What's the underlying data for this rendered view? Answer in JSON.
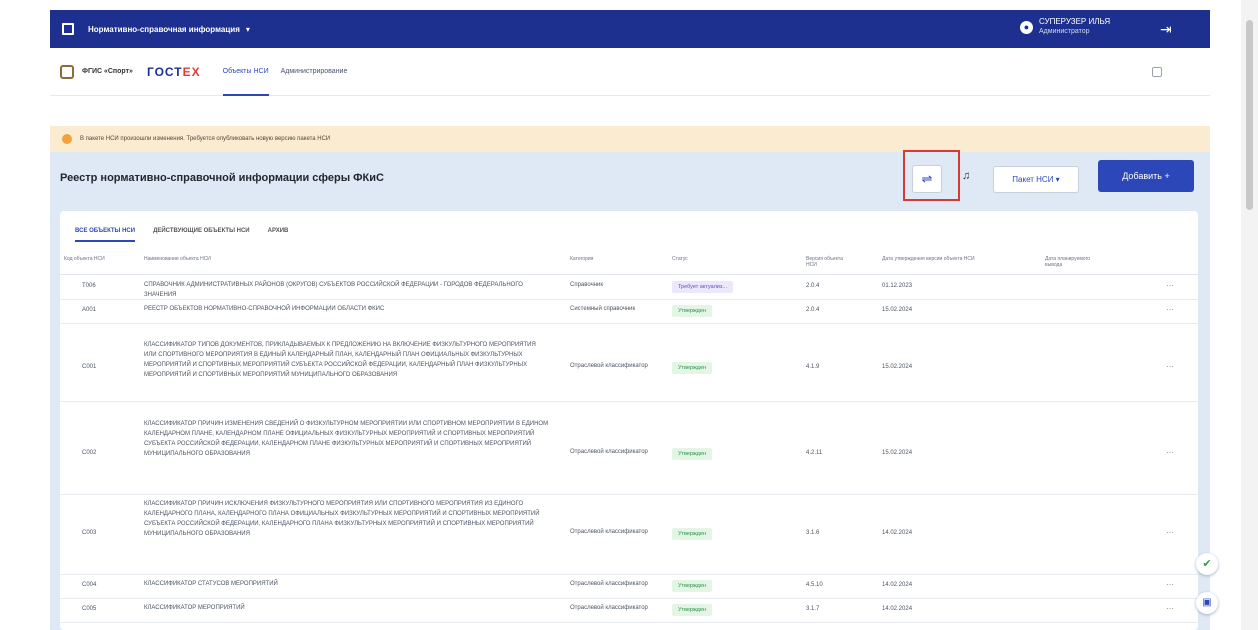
{
  "topbar": {
    "app_title": "Нормативно-справочная информация",
    "caret": "▾",
    "user_name": "СУПЕРУЗЕР ИЛЬЯ",
    "user_role": "Администратор",
    "logout_icon": "logout-icon",
    "bg_color": "#1d2f8f"
  },
  "nav": {
    "org": "ФГИС «Спорт»",
    "gost_blue": "ГОСТ",
    "gost_red": "ЕХ",
    "tabs": [
      "Объекты НСИ",
      "Администрирование"
    ]
  },
  "warning": {
    "text": "В пакете НСИ произошли изменения. Требуется опубликовать новую версию пакета НСИ"
  },
  "page": {
    "title": "Реестр нормативно-справочной информации сферы ФКиС",
    "paket_label": "Пакет НСИ",
    "add_label": "Добавить",
    "accent": "#2b47b8",
    "highlight_color": "#d63a36"
  },
  "tabs": [
    "ВСЕ ОБЪЕКТЫ НСИ",
    "ДЕЙСТВУЮЩИЕ ОБЪЕКТЫ НСИ",
    "АРХИВ"
  ],
  "table": {
    "headers": [
      "Код объекта НСИ",
      "Наименование объекта НСИ",
      "Категория",
      "Статус",
      "Версия объекта НСИ",
      "Дата утверждения версии объекта НСИ",
      "Дата планируемого вывода"
    ],
    "rows": [
      {
        "code": "Т006",
        "name": "СПРАВОЧНИК АДМИНИСТРАТИВНЫХ РАЙОНОВ (ОКРУГОВ) СУБЪЕКТОВ РОССИЙСКОЙ ФЕДЕРАЦИИ - ГОРОДОВ ФЕДЕРАЛЬНОГО ЗНАЧЕНИЯ",
        "category": "Справочник",
        "status": "Требует актуализ...",
        "version": "2.0.4",
        "date": "01.12.2023"
      },
      {
        "code": "А001",
        "name": "РЕЕСТР ОБЪЕКТОВ НОРМАТИВНО-СПРАВОЧНОЙ ИНФОРМАЦИИ ОБЛАСТИ ФКИС",
        "category": "Системный справочник",
        "status": "Утвержден",
        "version": "2.0.4",
        "date": "15.02.2024"
      },
      {
        "code": "С001",
        "name": "КЛАССИФИКАТОР ТИПОВ ДОКУМЕНТОВ, ПРИКЛАДЫВАЕМЫХ К ПРЕДЛОЖЕНИЮ НА ВКЛЮЧЕНИЕ ФИЗКУЛЬТУРНОГО МЕРОПРИЯТИЯ ИЛИ СПОРТИВНОГО МЕРОПРИЯТИЯ В ЕДИНЫЙ КАЛЕНДАРНЫЙ ПЛАН, КАЛЕНДАРНЫЙ ПЛАН ОФИЦИАЛЬНЫХ ФИЗКУЛЬТУРНЫХ МЕРОПРИЯТИЙ И СПОРТИВНЫХ МЕРОПРИЯТИЙ СУБЪЕКТА РОССИЙСКОЙ ФЕДЕРАЦИИ, КАЛЕНДАРНЫЙ ПЛАН ФИЗКУЛЬТУРНЫХ МЕРОПРИЯТИЙ И СПОРТИВНЫХ МЕРОПРИЯТИЙ МУНИЦИПАЛЬНОГО ОБРАЗОВАНИЯ",
        "category": "Отраслевой классификатор",
        "status": "Утвержден",
        "version": "4.1.9",
        "date": "15.02.2024"
      },
      {
        "code": "С002",
        "name": "КЛАССИФИКАТОР ПРИЧИН ИЗМЕНЕНИЯ СВЕДЕНИЙ О ФИЗКУЛЬТУРНОМ МЕРОПРИЯТИИ ИЛИ СПОРТИВНОМ МЕРОПРИЯТИИ В ЕДИНОМ КАЛЕНДАРНОМ ПЛАНЕ, КАЛЕНДАРНОМ ПЛАНЕ ОФИЦИАЛЬНЫХ ФИЗКУЛЬТУРНЫХ МЕРОПРИЯТИЙ И СПОРТИВНЫХ МЕРОПРИЯТИЙ СУБЪЕКТА РОССИЙСКОЙ ФЕДЕРАЦИИ, КАЛЕНДАРНОМ ПЛАНЕ ФИЗКУЛЬТУРНЫХ МЕРОПРИЯТИЙ И СПОРТИВНЫХ МЕРОПРИЯТИЙ МУНИЦИПАЛЬНОГО ОБРАЗОВАНИЯ",
        "category": "Отраслевой классификатор",
        "status": "Утвержден",
        "version": "4.2.11",
        "date": "15.02.2024"
      },
      {
        "code": "С003",
        "name": "КЛАССИФИКАТОР ПРИЧИН ИСКЛЮЧЕНИЯ ФИЗКУЛЬТУРНОГО МЕРОПРИЯТИЯ ИЛИ СПОРТИВНОГО МЕРОПРИЯТИЯ ИЗ ЕДИНОГО КАЛЕНДАРНОГО ПЛАНА, КАЛЕНДАРНОГО ПЛАНА ОФИЦИАЛЬНЫХ ФИЗКУЛЬТУРНЫХ МЕРОПРИЯТИЙ И СПОРТИВНЫХ МЕРОПРИЯТИЙ СУБЪЕКТА РОССИЙСКОЙ ФЕДЕРАЦИИ, КАЛЕНДАРНОГО ПЛАНА ФИЗКУЛЬТУРНЫХ МЕРОПРИЯТИЙ И СПОРТИВНЫХ МЕРОПРИЯТИЙ МУНИЦИПАЛЬНОГО ОБРАЗОВАНИЯ",
        "category": "Отраслевой классификатор",
        "status": "Утвержден",
        "version": "3.1.6",
        "date": "14.02.2024"
      },
      {
        "code": "С004",
        "name": "КЛАССИФИКАТОР СТАТУСОВ МЕРОПРИЯТИЙ",
        "category": "Отраслевой классификатор",
        "status": "Утвержден",
        "version": "4.5.10",
        "date": "14.02.2024"
      },
      {
        "code": "С005",
        "name": "КЛАССИФИКАТОР МЕРОПРИЯТИЙ",
        "category": "Отраслевой классификатор",
        "status": "Утвержден",
        "version": "3.1.7",
        "date": "14.02.2024"
      }
    ]
  }
}
